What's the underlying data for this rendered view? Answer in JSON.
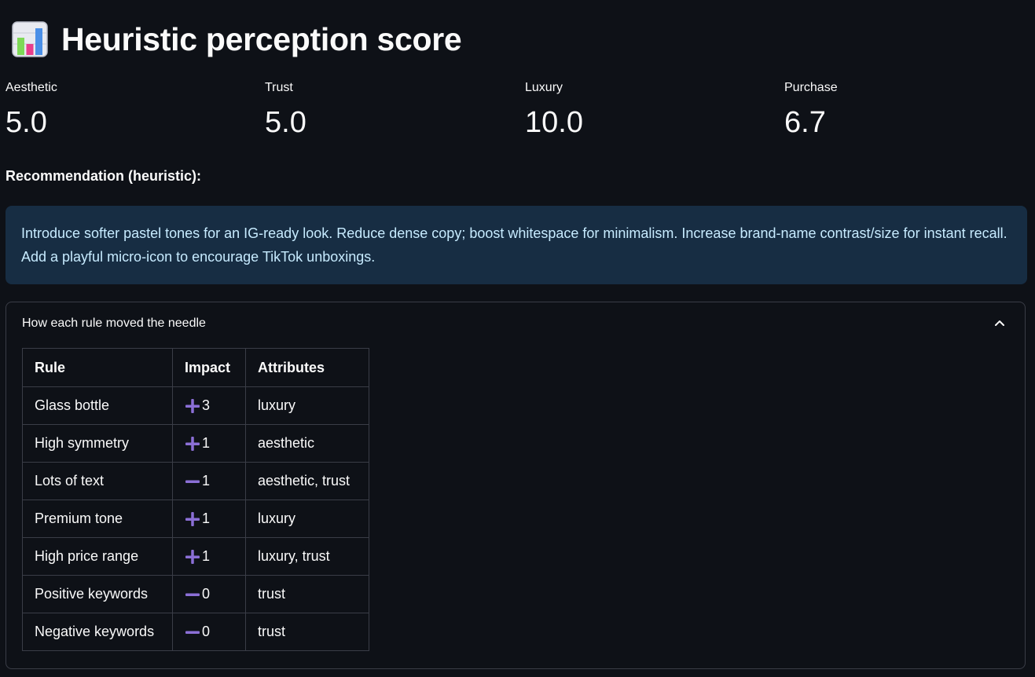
{
  "header": {
    "title": "Heuristic perception score",
    "icon": "bar-chart-emoji-icon"
  },
  "metrics": [
    {
      "label": "Aesthetic",
      "value": "5.0"
    },
    {
      "label": "Trust",
      "value": "5.0"
    },
    {
      "label": "Luxury",
      "value": "10.0"
    },
    {
      "label": "Purchase",
      "value": "6.7"
    }
  ],
  "recommendation": {
    "heading": "Recommendation (heuristic):",
    "text": "Introduce softer pastel tones for an IG-ready look. Reduce dense copy; boost whitespace for minimalism. Increase brand-name contrast/size for instant recall. Add a playful micro-icon to encourage TikTok unboxings."
  },
  "expander": {
    "label": "How each rule moved the needle",
    "expanded": true
  },
  "table": {
    "headers": {
      "rule": "Rule",
      "impact": "Impact",
      "attributes": "Attributes"
    },
    "rows": [
      {
        "rule": "Glass bottle",
        "sign": "plus",
        "impact": "3",
        "attributes": "luxury"
      },
      {
        "rule": "High symmetry",
        "sign": "plus",
        "impact": "1",
        "attributes": "aesthetic"
      },
      {
        "rule": "Lots of text",
        "sign": "minus",
        "impact": "1",
        "attributes": "aesthetic, trust"
      },
      {
        "rule": "Premium tone",
        "sign": "plus",
        "impact": "1",
        "attributes": "luxury"
      },
      {
        "rule": "High price range",
        "sign": "plus",
        "impact": "1",
        "attributes": "luxury, trust"
      },
      {
        "rule": "Positive keywords",
        "sign": "minus",
        "impact": "0",
        "attributes": "trust"
      },
      {
        "rule": "Negative keywords",
        "sign": "minus",
        "impact": "0",
        "attributes": "trust"
      }
    ]
  },
  "colors": {
    "background": "#0e1117",
    "text": "#fafafa",
    "info_bg": "#172d43",
    "info_text": "#c7ebff",
    "border": "#3a3d47",
    "sign_accent": "#8b6fd6"
  }
}
